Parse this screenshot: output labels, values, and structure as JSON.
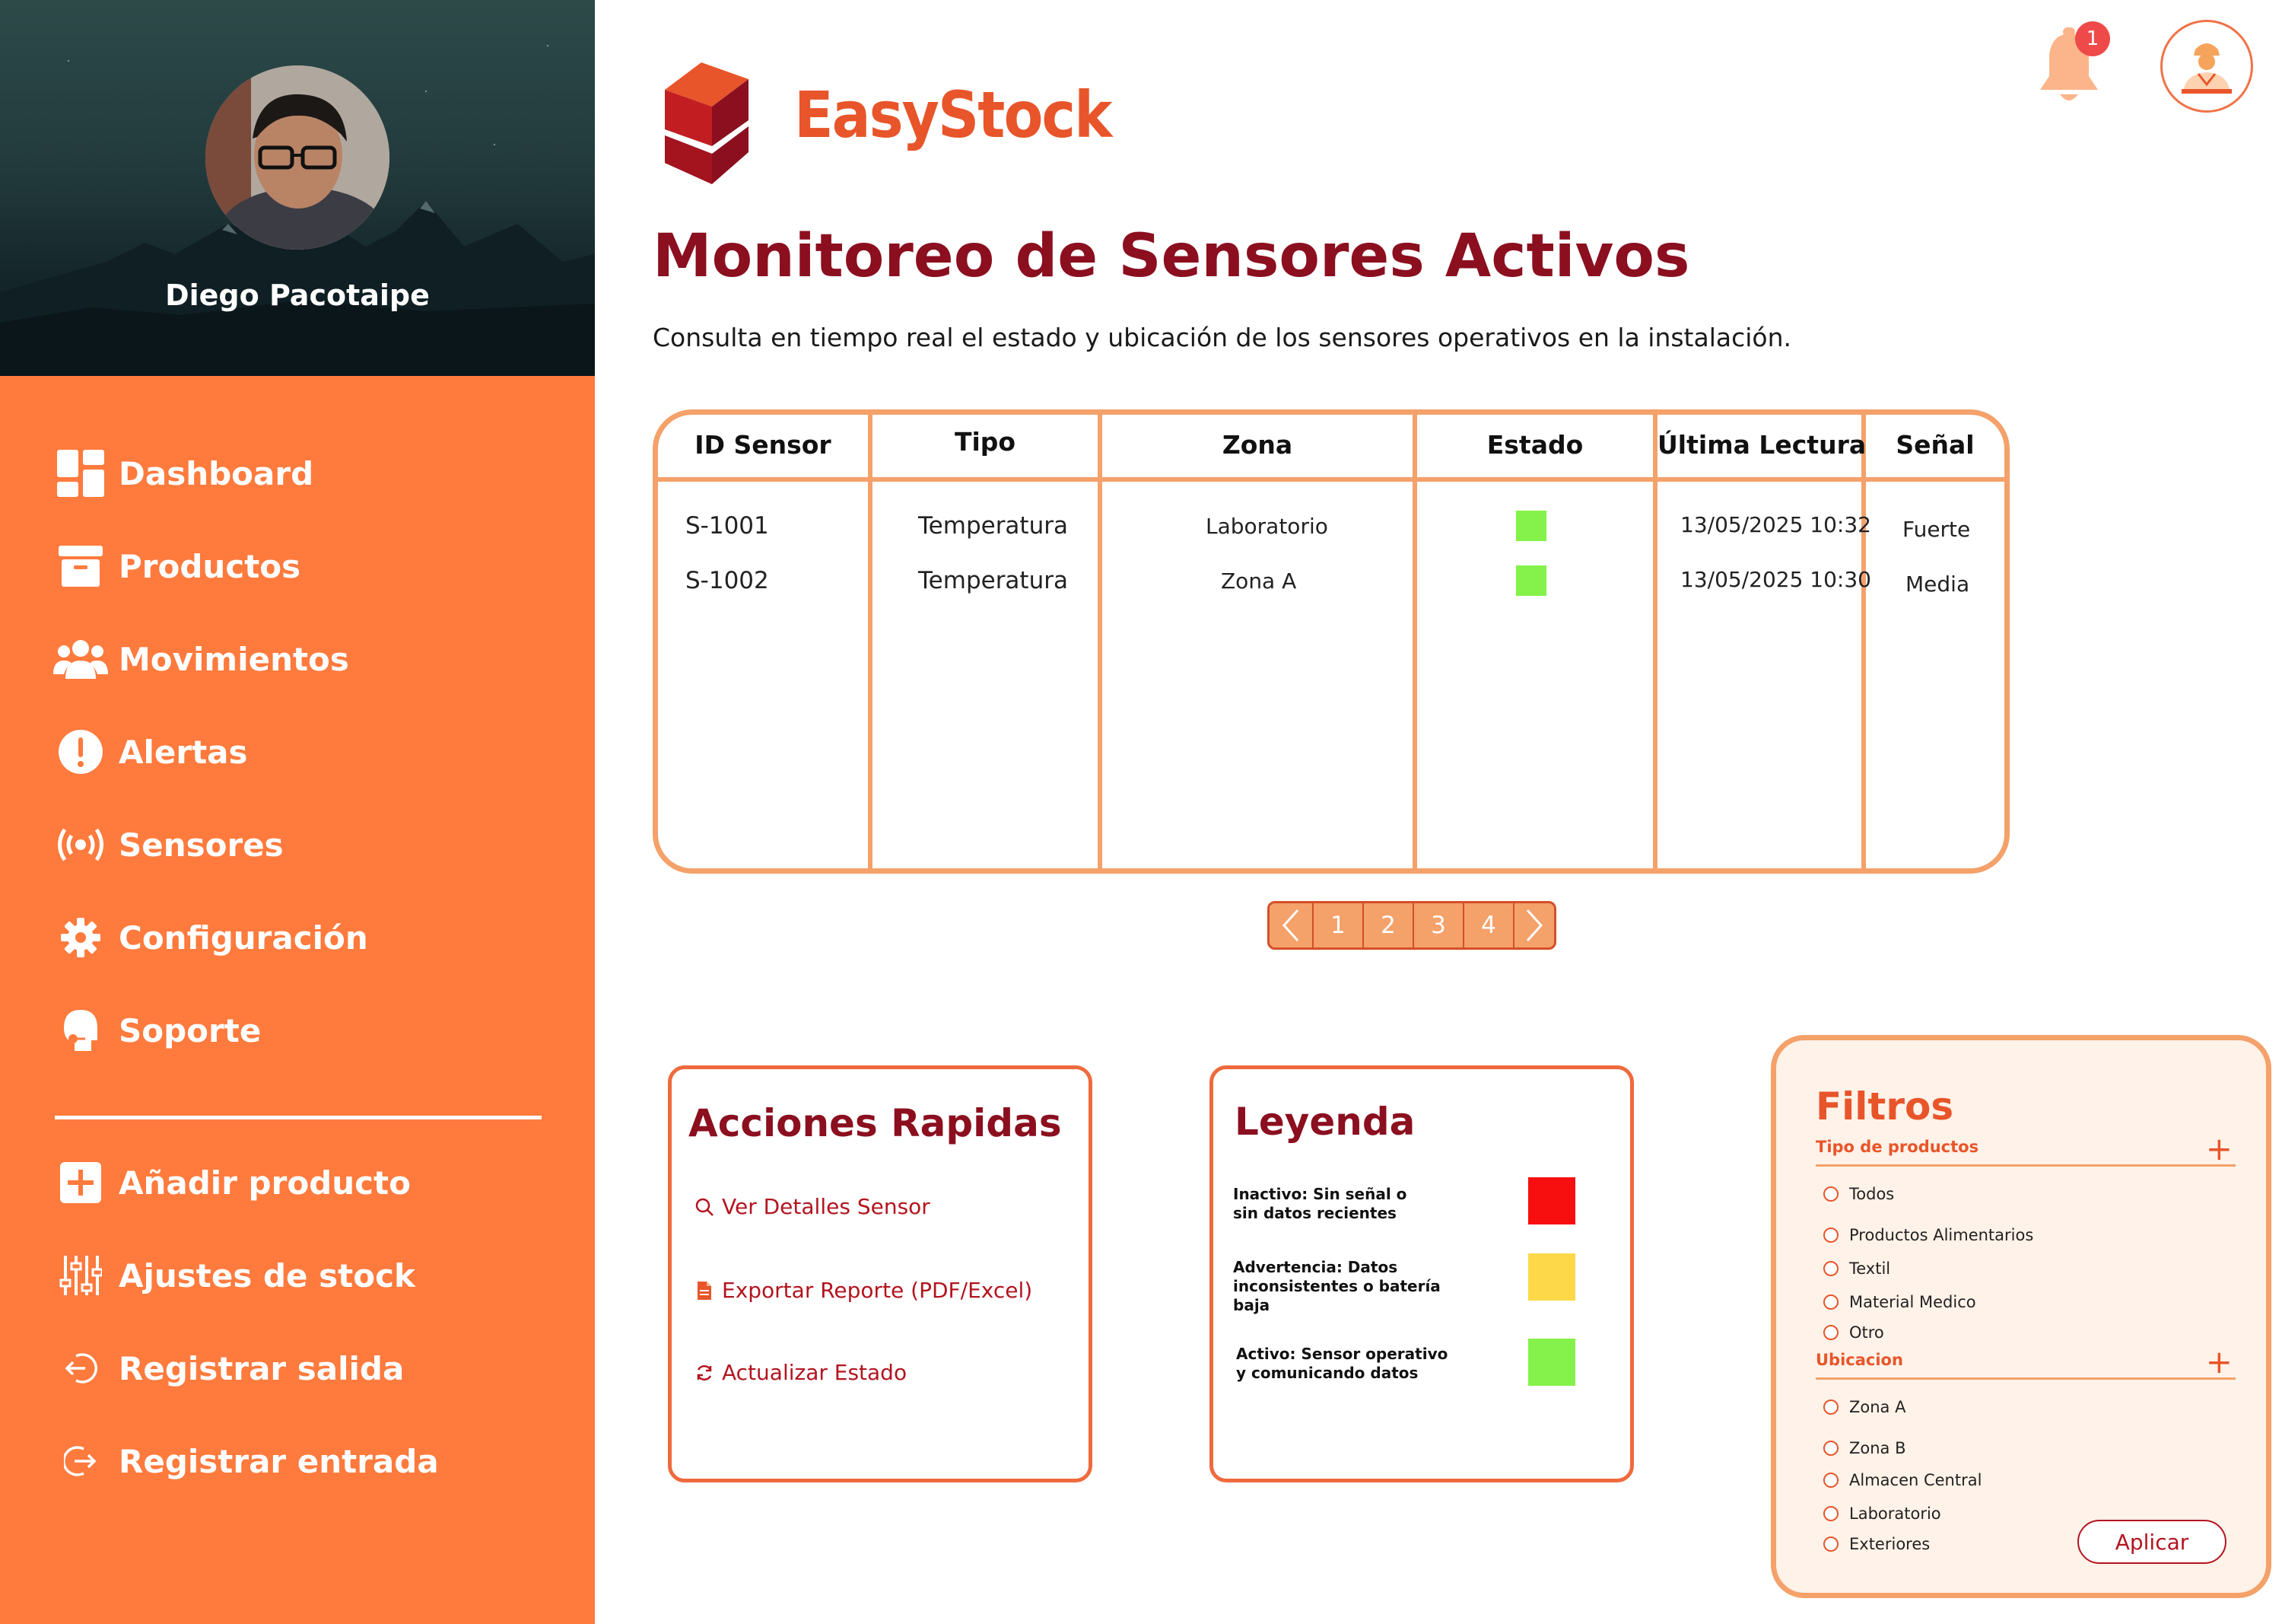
{
  "profile": {
    "name": "Diego Pacotaipe"
  },
  "sidebar": {
    "main_items": [
      {
        "label": "Dashboard",
        "icon": "dashboard-icon"
      },
      {
        "label": "Productos",
        "icon": "archive-box-icon"
      },
      {
        "label": "Movimientos",
        "icon": "users-icon"
      },
      {
        "label": "Alertas",
        "icon": "alert-icon"
      },
      {
        "label": "Sensores",
        "icon": "sensor-icon"
      },
      {
        "label": "Configuración",
        "icon": "gear-icon"
      },
      {
        "label": "Soporte",
        "icon": "support-icon"
      }
    ],
    "secondary_items": [
      {
        "label": "Añadir producto",
        "icon": "add-icon"
      },
      {
        "label": "Ajustes de stock",
        "icon": "sliders-icon"
      },
      {
        "label": "Registrar salida",
        "icon": "logout-icon"
      },
      {
        "label": "Registrar entrada",
        "icon": "login-icon"
      }
    ]
  },
  "header": {
    "brand": "EasyStock",
    "notifications_count": "1"
  },
  "page": {
    "title": "Monitoreo de Sensores Activos",
    "subtitle": "Consulta en tiempo real el estado y ubicación de los sensores operativos en la instalación."
  },
  "table": {
    "columns": [
      "ID Sensor",
      "Tipo",
      "Zona",
      "Estado",
      "Última Lectura",
      "Señal"
    ],
    "rows": [
      {
        "id": "S-1001",
        "tipo": "Temperatura",
        "zona": "Laboratorio",
        "estado": "Activo",
        "estado_color": "#84f24a",
        "lectura": "13/05/2025 10:32",
        "senal": "Fuerte"
      },
      {
        "id": "S-1002",
        "tipo": "Temperatura",
        "zona": "Zona A",
        "estado": "Activo",
        "estado_color": "#84f24a",
        "lectura": "13/05/2025 10:30",
        "senal": "Media"
      }
    ]
  },
  "pagination": {
    "pages": [
      "1",
      "2",
      "3",
      "4"
    ]
  },
  "quick_actions": {
    "title": "Acciones Rapidas",
    "items": [
      {
        "label": "Ver Detalles Sensor",
        "icon": "search-icon"
      },
      {
        "label": "Exportar Reporte (PDF/Excel)",
        "icon": "document-icon"
      },
      {
        "label": "Actualizar Estado",
        "icon": "refresh-icon"
      }
    ]
  },
  "legend": {
    "title": "Leyenda",
    "items": [
      {
        "line1": "Inactivo: Sin señal o",
        "line2": "sin datos recientes",
        "color": "#f70f0f"
      },
      {
        "line1": "Advertencia: Datos",
        "line2": "inconsistentes o batería baja",
        "color": "#fdd94a"
      },
      {
        "line1": "Activo: Sensor operativo",
        "line2": "y comunicando datos",
        "color": "#84f24a"
      }
    ]
  },
  "filters": {
    "title": "Filtros",
    "product_type_label": "Tipo de productos",
    "product_types": [
      "Todos",
      "Productos Alimentarios",
      "Textil",
      "Material Medico",
      "Otro"
    ],
    "location_label": "Ubicacion",
    "locations": [
      "Zona A",
      "Zona B",
      "Almacen Central",
      "Laboratorio",
      "Exteriores"
    ],
    "apply_label": "Aplicar"
  },
  "colors": {
    "sidebar": "#ff7a3d",
    "title": "#8b0f1f",
    "accent": "#e8552a",
    "table_border": "#f4a16a"
  }
}
